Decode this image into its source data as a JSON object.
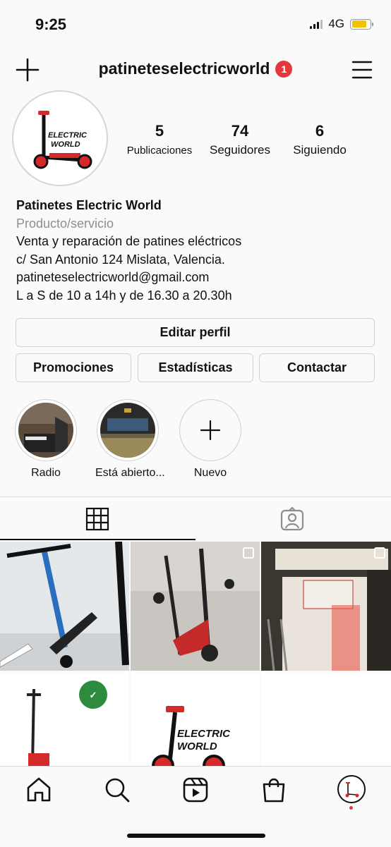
{
  "status_bar": {
    "time": "9:25",
    "network": "4G"
  },
  "header": {
    "username": "patineteselectricworld",
    "notification_count": "1"
  },
  "stats": {
    "posts": {
      "value": "5",
      "label": "Publicaciones"
    },
    "followers": {
      "value": "74",
      "label": "Seguidores"
    },
    "following": {
      "value": "6",
      "label": "Siguiendo"
    }
  },
  "profile": {
    "name": "Patinetes Electric World",
    "category": "Producto/servicio",
    "bio": [
      "Venta y reparación de patines eléctricos",
      "c/ San Antonio 124 Mislata, Valencia.",
      "patineteselectricworld@gmail.com",
      "L a S de 10 a 14h y de 16.30 a 20.30h"
    ]
  },
  "buttons": {
    "edit_profile": "Editar perfil",
    "promotions": "Promociones",
    "statistics": "Estadísticas",
    "contact": "Contactar"
  },
  "highlights": [
    {
      "label": "Radio",
      "icon": "radio-highlight"
    },
    {
      "label": "Está abierto...",
      "icon": "store-highlight"
    },
    {
      "label": "Nuevo",
      "icon": "plus-icon"
    }
  ],
  "logo_text": [
    "ELECTRIC",
    "WORLD"
  ],
  "colors": {
    "accent_red": "#e0393e",
    "battery": "#f2c300",
    "brand_red": "#d42a2a"
  },
  "bottom_nav": [
    "home-icon",
    "search-icon",
    "reels-icon",
    "shop-icon",
    "profile-avatar"
  ]
}
